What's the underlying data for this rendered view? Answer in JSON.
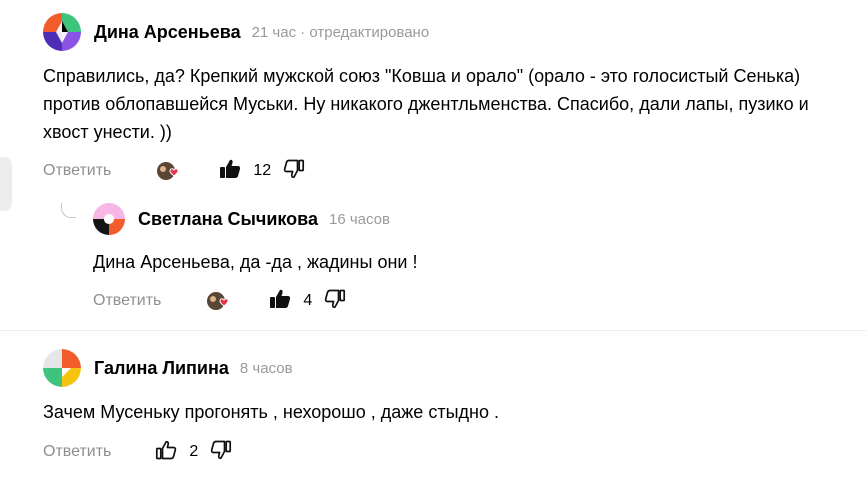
{
  "comments": [
    {
      "author": "Дина Арсеньева",
      "meta": "21 час · отредактировано",
      "text": "Справились, да? Крепкий мужской союз \"Ковша и орало\" (орало - это голосистый Сенька) против облопавшейся Муськи. Ну никакого джентльменства. Спасибо, дали лапы, пузико и хвост унести. ))",
      "reply_label": "Ответить",
      "likes": "12",
      "liked": true,
      "avatar_colors": [
        "#f25c2a",
        "#3ec47d",
        "#8a53e6",
        "#4c2fb6"
      ]
    },
    {
      "author": "Светлана Сычикова",
      "meta": "16 часов",
      "text": "Дина Арсеньева, да -да , жадины они !",
      "reply_label": "Ответить",
      "likes": "4",
      "liked": true,
      "avatar_colors": [
        "#f7b6e6",
        "#f25c2a",
        "#141414",
        "#ffffff"
      ]
    },
    {
      "author": "Галина Липина",
      "meta": "8 часов",
      "text": "Зачем Мусеньку прогонять , нехорошо , даже стыдно .",
      "reply_label": "Ответить",
      "likes": "2",
      "liked": false,
      "avatar_colors": [
        "#f25c2a",
        "#f6c30f",
        "#3ec47d",
        "#e6e6e6"
      ]
    }
  ],
  "icons": {
    "reactions": "reaction-avatar-heart-icon",
    "like": "thumbs-up-icon",
    "dislike": "thumbs-down-icon"
  },
  "colors": {
    "heart": "#e8324a",
    "meta": "#9a9a9a",
    "reply": "#8f8f8f"
  }
}
